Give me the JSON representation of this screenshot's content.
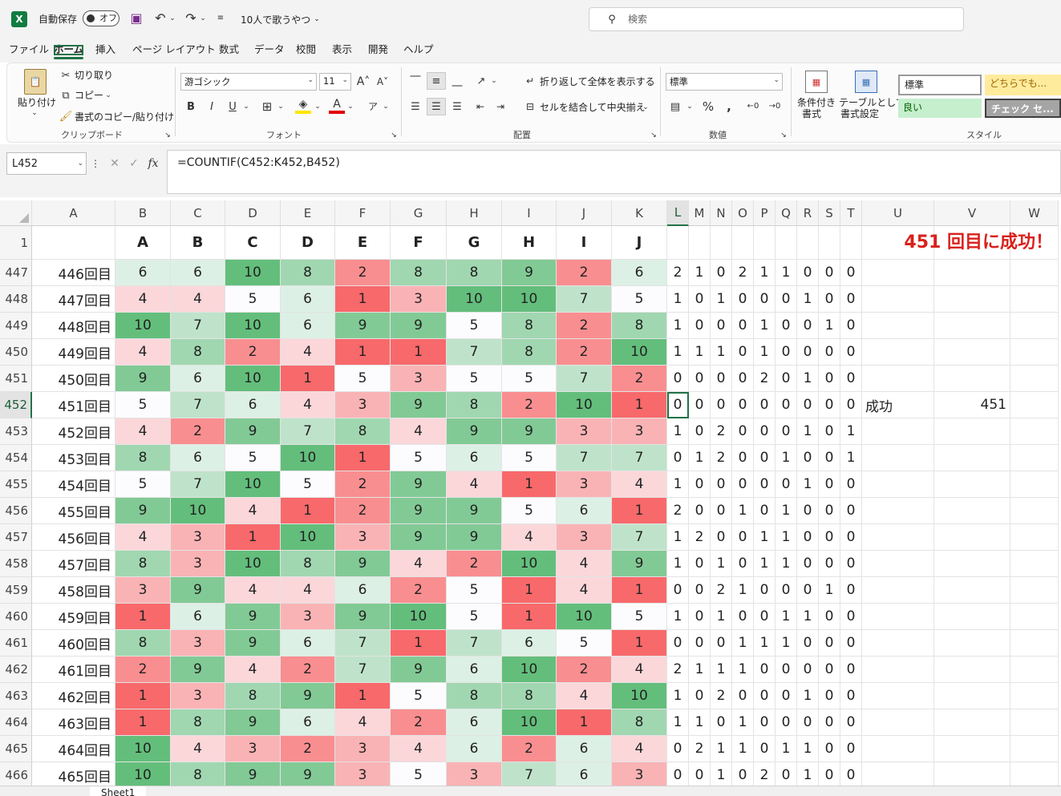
{
  "titlebar": {
    "autosave_label": "自動保存",
    "autosave_state": "オフ",
    "file_name": "10人で歌うやつ",
    "search_placeholder": "検索"
  },
  "menu": [
    "ファイル",
    "ホーム",
    "挿入",
    "ページ レイアウト",
    "数式",
    "データ",
    "校閲",
    "表示",
    "開発",
    "ヘルプ"
  ],
  "ribbon": {
    "paste": "貼り付け",
    "cut": "切り取り",
    "copy": "コピー",
    "format_painter": "書式のコピー/貼り付け",
    "group_clipboard": "クリップボード",
    "font_name": "游ゴシック",
    "font_size": "11",
    "group_font": "フォント",
    "wrap_text": "折り返して全体を表示する",
    "merge_center": "セルを結合して中央揃え",
    "group_alignment": "配置",
    "number_format": "標準",
    "group_number": "数値",
    "conditional_format": [
      "条件付き",
      "書式"
    ],
    "format_as_table": [
      "テーブルとして",
      "書式設定"
    ],
    "style_normal": "標準",
    "style_neutral": "どちらでも...",
    "style_good": "良い",
    "style_check": "チェック セ...",
    "group_styles": "スタイル"
  },
  "formula_bar": {
    "name_box": "L452",
    "formula": "=COUNTIF(C452:K452,B452)"
  },
  "grid": {
    "columns": [
      "A",
      "B",
      "C",
      "D",
      "E",
      "F",
      "G",
      "H",
      "I",
      "J",
      "K",
      "L",
      "M",
      "N",
      "O",
      "P",
      "Q",
      "R",
      "S",
      "T",
      "U",
      "V",
      "W"
    ],
    "active_column": "L",
    "active_row": "452",
    "header_row": {
      "num": "1",
      "labels": [
        "A",
        "B",
        "C",
        "D",
        "E",
        "F",
        "G",
        "H",
        "I",
        "J"
      ]
    },
    "banner": "451 回目に成功！",
    "rows": [
      {
        "num": "447",
        "label": "446回目",
        "v": [
          6,
          6,
          10,
          8,
          2,
          8,
          8,
          9,
          2,
          6
        ],
        "c": [
          2,
          1,
          0,
          2,
          1,
          1,
          0,
          0,
          0
        ]
      },
      {
        "num": "448",
        "label": "447回目",
        "v": [
          4,
          4,
          5,
          6,
          1,
          3,
          10,
          10,
          7,
          5
        ],
        "c": [
          1,
          0,
          1,
          0,
          0,
          0,
          1,
          0,
          0
        ]
      },
      {
        "num": "449",
        "label": "448回目",
        "v": [
          10,
          7,
          10,
          6,
          9,
          9,
          5,
          8,
          2,
          8
        ],
        "c": [
          1,
          0,
          0,
          0,
          1,
          0,
          0,
          1,
          0
        ]
      },
      {
        "num": "450",
        "label": "449回目",
        "v": [
          4,
          8,
          2,
          4,
          1,
          1,
          7,
          8,
          2,
          10
        ],
        "c": [
          1,
          1,
          1,
          0,
          1,
          0,
          0,
          0,
          0
        ]
      },
      {
        "num": "451",
        "label": "450回目",
        "v": [
          9,
          6,
          10,
          1,
          5,
          3,
          5,
          5,
          7,
          2
        ],
        "c": [
          0,
          0,
          0,
          0,
          2,
          0,
          1,
          0,
          0
        ]
      },
      {
        "num": "452",
        "label": "451回目",
        "v": [
          5,
          7,
          6,
          4,
          3,
          9,
          8,
          2,
          10,
          1
        ],
        "c": [
          0,
          0,
          0,
          0,
          0,
          0,
          0,
          0,
          0
        ],
        "u": "成功",
        "w": "451"
      },
      {
        "num": "453",
        "label": "452回目",
        "v": [
          4,
          2,
          9,
          7,
          8,
          4,
          9,
          9,
          3,
          3
        ],
        "c": [
          1,
          0,
          2,
          0,
          0,
          0,
          1,
          0,
          1
        ]
      },
      {
        "num": "454",
        "label": "453回目",
        "v": [
          8,
          6,
          5,
          10,
          1,
          5,
          6,
          5,
          7,
          7
        ],
        "c": [
          0,
          1,
          2,
          0,
          0,
          1,
          0,
          0,
          1
        ]
      },
      {
        "num": "455",
        "label": "454回目",
        "v": [
          5,
          7,
          10,
          5,
          2,
          9,
          4,
          1,
          3,
          4
        ],
        "c": [
          1,
          0,
          0,
          0,
          0,
          0,
          1,
          0,
          0
        ]
      },
      {
        "num": "456",
        "label": "455回目",
        "v": [
          9,
          10,
          4,
          1,
          2,
          9,
          9,
          5,
          6,
          1
        ],
        "c": [
          2,
          0,
          0,
          1,
          0,
          1,
          0,
          0,
          0
        ]
      },
      {
        "num": "457",
        "label": "456回目",
        "v": [
          4,
          3,
          1,
          10,
          3,
          9,
          9,
          4,
          3,
          7
        ],
        "c": [
          1,
          2,
          0,
          0,
          1,
          1,
          0,
          0,
          0
        ]
      },
      {
        "num": "458",
        "label": "457回目",
        "v": [
          8,
          3,
          10,
          8,
          9,
          4,
          2,
          10,
          4,
          9
        ],
        "c": [
          1,
          0,
          1,
          0,
          1,
          1,
          0,
          0,
          0
        ]
      },
      {
        "num": "459",
        "label": "458回目",
        "v": [
          3,
          9,
          4,
          4,
          6,
          2,
          5,
          1,
          4,
          1
        ],
        "c": [
          0,
          0,
          2,
          1,
          0,
          0,
          0,
          1,
          0
        ]
      },
      {
        "num": "460",
        "label": "459回目",
        "v": [
          1,
          6,
          9,
          3,
          9,
          10,
          5,
          1,
          10,
          5
        ],
        "c": [
          1,
          0,
          1,
          0,
          0,
          1,
          1,
          0,
          0
        ]
      },
      {
        "num": "461",
        "label": "460回目",
        "v": [
          8,
          3,
          9,
          6,
          7,
          1,
          7,
          6,
          5,
          1
        ],
        "c": [
          0,
          0,
          0,
          1,
          1,
          1,
          0,
          0,
          0
        ]
      },
      {
        "num": "462",
        "label": "461回目",
        "v": [
          2,
          9,
          4,
          2,
          7,
          9,
          6,
          10,
          2,
          4
        ],
        "c": [
          2,
          1,
          1,
          1,
          0,
          0,
          0,
          0,
          0
        ]
      },
      {
        "num": "463",
        "label": "462回目",
        "v": [
          1,
          3,
          8,
          9,
          1,
          5,
          8,
          8,
          4,
          10
        ],
        "c": [
          1,
          0,
          2,
          0,
          0,
          0,
          1,
          0,
          0
        ]
      },
      {
        "num": "464",
        "label": "463回目",
        "v": [
          1,
          8,
          9,
          6,
          4,
          2,
          6,
          10,
          1,
          8
        ],
        "c": [
          1,
          1,
          0,
          1,
          0,
          0,
          0,
          0,
          0
        ]
      },
      {
        "num": "465",
        "label": "464回目",
        "v": [
          10,
          4,
          3,
          2,
          3,
          4,
          6,
          2,
          6,
          4
        ],
        "c": [
          0,
          2,
          1,
          1,
          0,
          1,
          1,
          0,
          0
        ]
      },
      {
        "num": "466",
        "label": "465回目",
        "v": [
          10,
          8,
          9,
          9,
          3,
          5,
          3,
          7,
          6,
          3
        ],
        "c": [
          0,
          0,
          1,
          0,
          2,
          0,
          1,
          0,
          0
        ]
      }
    ]
  },
  "sheet_tab": "Sheet1",
  "colors": {
    "accent": "#217346",
    "red": "#f8696b",
    "white": "#fcfcff",
    "green": "#63be7b",
    "banner": "#d9211c"
  }
}
